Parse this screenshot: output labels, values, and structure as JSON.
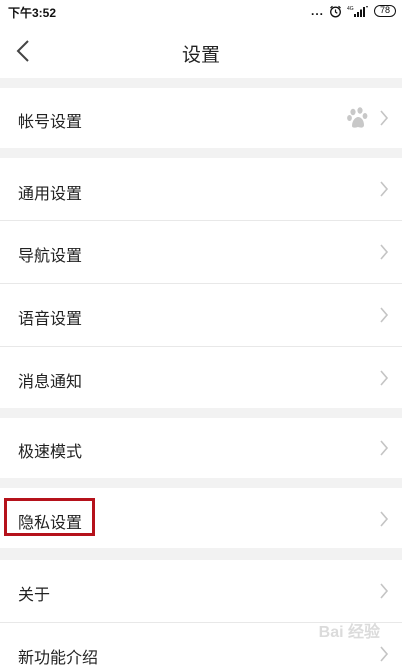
{
  "status_bar": {
    "time": "下午3:52",
    "dots": "...",
    "battery": "78"
  },
  "nav": {
    "title": "设置"
  },
  "rows": [
    {
      "label": "帐号设置",
      "has_baidu_icon": true
    },
    {
      "label": "通用设置"
    },
    {
      "label": "导航设置"
    },
    {
      "label": "语音设置"
    },
    {
      "label": "消息通知"
    },
    {
      "label": "极速模式"
    },
    {
      "label": "隐私设置",
      "highlighted": true
    },
    {
      "label": "关于"
    },
    {
      "label": "新功能介绍"
    }
  ],
  "watermark": "Bai 经验",
  "colors": {
    "highlight": "#b5121b",
    "background": "#f2f2f2",
    "row": "#ffffff",
    "chevron": "#c4c4c4"
  }
}
